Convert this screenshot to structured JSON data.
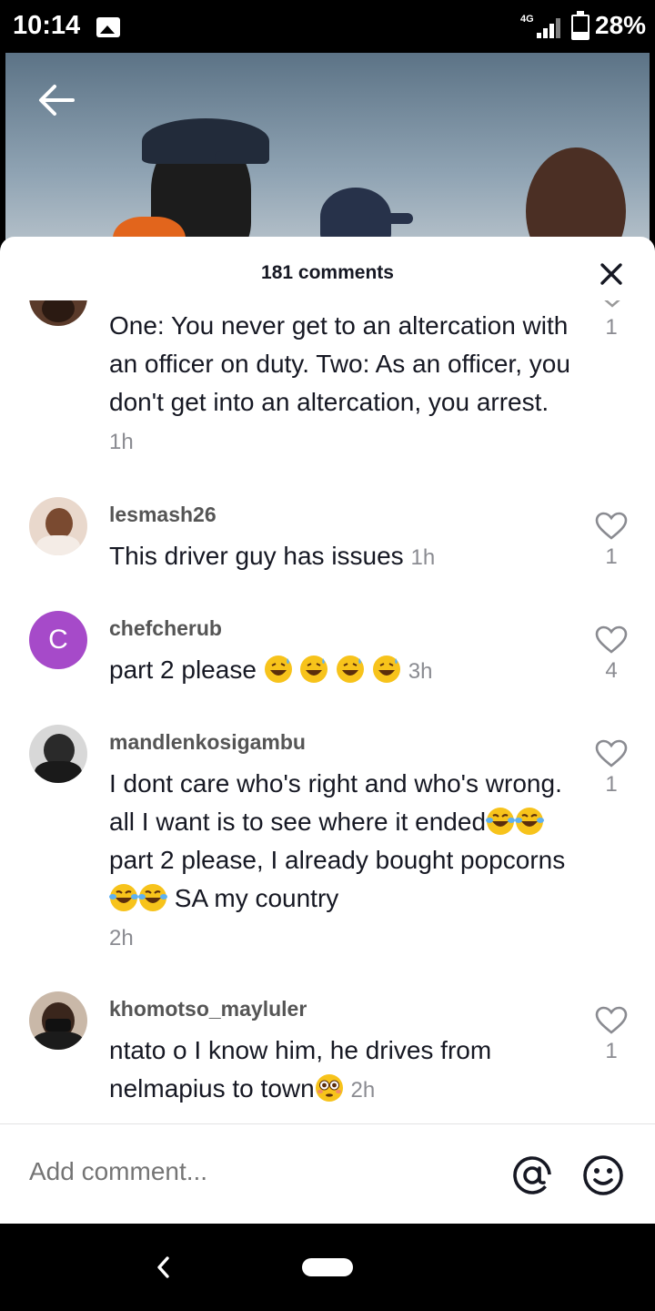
{
  "status_bar": {
    "time": "10:14",
    "network": "4G",
    "battery": "28%",
    "battery_level": 0.28
  },
  "video": {
    "back_icon": "arrow-left-icon"
  },
  "comments_sheet": {
    "title": "181 comments",
    "close_icon": "close-icon",
    "comments": [
      {
        "username": "",
        "text": "One: You never get to an altercation with an officer on duty. Two: As an officer, you don't get into an altercation, you arrest.",
        "time": "1h",
        "likes": "1"
      },
      {
        "username": "lesmash26",
        "text": "This driver guy has issues",
        "time": "1h",
        "likes": "1"
      },
      {
        "username": "chefcherub",
        "avatar_letter": "C",
        "text": "part 2 please",
        "emojis": [
          "grinning-sweat",
          "grinning-sweat",
          "grinning-sweat",
          "grinning-sweat"
        ],
        "time": "3h",
        "likes": "4"
      },
      {
        "username": "mandlenkosigambu",
        "text_line1": "I dont care who's right and who's wrong. all I want is to see where it ended",
        "text_line2": " part 2 please, I already bought popcorns",
        "text_line3": " SA my country",
        "emojis": [
          "tears-of-joy",
          "tears-of-joy"
        ],
        "time": "2h",
        "likes": "1"
      },
      {
        "username": "khomotso_mayluler",
        "text": "ntato o I know him, he drives from nelmapius to town",
        "emojis": [
          "flushed"
        ],
        "time": "2h",
        "likes": "1"
      }
    ]
  },
  "input": {
    "placeholder": "Add comment...",
    "mention_icon": "at-icon",
    "emoji_icon": "emoji-icon"
  },
  "colors": {
    "avatar_purple": "#a64ac9",
    "meta_gray": "#8a8b91",
    "text_dark": "#161823"
  }
}
